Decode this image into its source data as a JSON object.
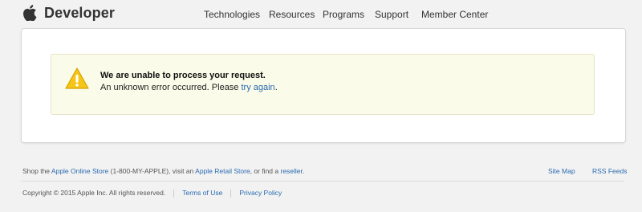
{
  "header": {
    "logo_text": "Developer",
    "nav": [
      "Technologies",
      "Resources",
      "Programs",
      "Support",
      "Member Center"
    ]
  },
  "alert": {
    "title": "We are unable to process your request.",
    "message_prefix": "An unknown error occurred. Please ",
    "link_text": "try again",
    "message_suffix": "."
  },
  "footer": {
    "shop_prefix": "Shop the ",
    "online_store": "Apple Online Store",
    "phone_text": " (1-800-MY-APPLE), visit an ",
    "retail_store": "Apple Retail Store",
    "find_text": ", or find a ",
    "reseller": "reseller",
    "end": ".",
    "site_map": "Site Map",
    "rss_feeds": "RSS Feeds",
    "copyright": "Copyright © 2015 Apple Inc. All rights reserved.",
    "terms": "Terms of Use",
    "privacy": "Privacy Policy"
  },
  "colors": {
    "link": "#2a6bb0",
    "alert_bg": "#fbfbe9",
    "warning_yellow": "#f5c518",
    "page_bg": "#f2f2f2"
  },
  "icons": [
    "apple-logo-icon",
    "warning-icon"
  ]
}
